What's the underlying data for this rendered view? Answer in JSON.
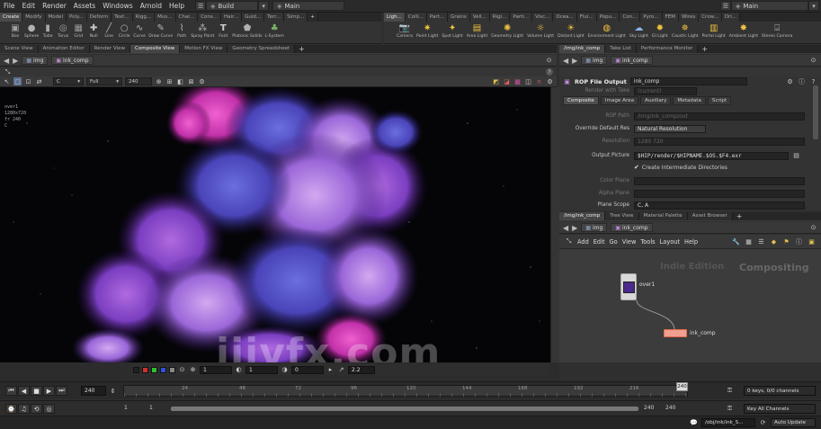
{
  "menu": {
    "items": [
      "File",
      "Edit",
      "Render",
      "Assets",
      "Windows",
      "Arnold",
      "Help"
    ],
    "desktop": "Build",
    "desktop_right": "Main",
    "desktop_center": "Main"
  },
  "shelf_left": {
    "tabs": [
      "Create",
      "Modify",
      "Model",
      "Poly...",
      "Deform",
      "Text...",
      "Rigg...",
      "Mus...",
      "Char...",
      "Cons...",
      "Hair...",
      "Guid...",
      "Terr...",
      "Simp..."
    ],
    "tools": [
      "Box",
      "Sphere",
      "Tube",
      "Torus",
      "Grid",
      "Null",
      "Line",
      "Circle",
      "Curve",
      "Draw Curve",
      "Path",
      "Spray Paint",
      "Font",
      "Platonic Solids",
      "L-System"
    ]
  },
  "shelf_right": {
    "tabs": [
      "Ligh...",
      "Colli...",
      "Part...",
      "Grains",
      "Vell...",
      "Rigi...",
      "Parti...",
      "Visc...",
      "Ocea...",
      "Flui...",
      "Popu...",
      "Con...",
      "Pyro...",
      "FEM",
      "Wires",
      "Crow...",
      "Dri..."
    ],
    "tools": [
      "Camera",
      "Point Light",
      "Spot Light",
      "Area Light",
      "Geometry Light",
      "Volume Light",
      "Distant Light",
      "Environment Light",
      "Sky Light",
      "GI Light",
      "Caustic Light",
      "Portal Light",
      "Ambient Light",
      "Stereo Camera"
    ]
  },
  "viewer": {
    "tabs": [
      "Scene View",
      "Animation Editor",
      "Render View",
      "Composite View",
      "Motion FX View",
      "Geometry Spreadsheet"
    ],
    "path_obj": "img",
    "path_node": "ink_comp",
    "channel": "C",
    "resolution": "Full",
    "frame": "240",
    "info_lines": [
      "over1",
      "1280x720",
      "fr 240",
      "C"
    ],
    "bottom_fields": [
      "1",
      "1",
      "0",
      "2.2"
    ]
  },
  "params": {
    "tabs_top": [
      "/img/ink_comp",
      "Take List",
      "Performance Monitor"
    ],
    "path_obj": "img",
    "path_node": "ink_comp",
    "node_type": "ROP File Output",
    "node_name": "ink_comp",
    "section_tabs": [
      "Composite",
      "Image Area",
      "Auxiliary",
      "Metadata",
      "Script"
    ],
    "rows": [
      {
        "label": "Render with Take",
        "value": "(current)",
        "dim": true
      },
      {
        "label": "ROP Path",
        "value": "/img/ink_comp/out",
        "dim": true
      },
      {
        "label": "Override Default Res",
        "value": "Natural Resolution",
        "dim": false
      },
      {
        "label": "Resolution",
        "value": "1280        720",
        "dim": true
      },
      {
        "label": "Output Picture",
        "value": "$HIP/render/$HIPNAME.$OS.$F4.exr",
        "dim": false
      },
      {
        "label": "",
        "value": "Create Intermediate Directories",
        "dim": false
      },
      {
        "label": "Color Plane",
        "value": "",
        "dim": true
      },
      {
        "label": "Alpha Plane",
        "value": "",
        "dim": true
      },
      {
        "label": "Plane Scope",
        "value": "C, A",
        "dim": false
      }
    ]
  },
  "network": {
    "tabs": [
      "/img/ink_comp",
      "Tree View",
      "Material Palette",
      "Asset Browser"
    ],
    "path_obj": "img",
    "path_node": "ink_comp",
    "menu": [
      "Add",
      "Edit",
      "Go",
      "View",
      "Tools",
      "Layout",
      "Help"
    ],
    "edition": "Indie Edition",
    "context": "Compositing",
    "nodes": [
      "over1",
      "ink_comp"
    ]
  },
  "timeline": {
    "frame": "240",
    "ticks": [
      "24",
      "48",
      "72",
      "96",
      "120",
      "144",
      "168",
      "192",
      "216"
    ],
    "current": "240",
    "range_start": "1",
    "range_start2": "1",
    "range_end": "240",
    "range_end2": "240",
    "keys_info": "0 keys, 0/0 channels",
    "key_all": "Key All Channels"
  },
  "status": {
    "path": "/obj/ink/ink_S...",
    "auto_update": "Auto Update"
  },
  "watermark": "iiivfx.com"
}
